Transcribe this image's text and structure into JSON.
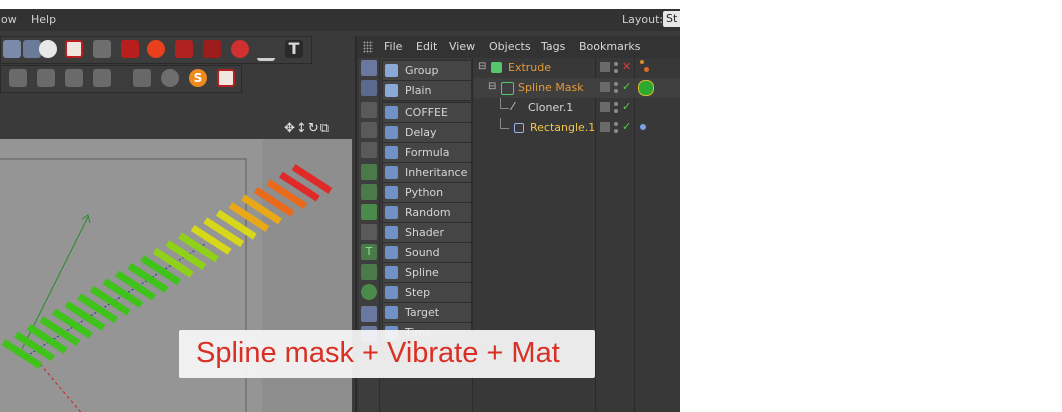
{
  "menubar": {
    "items": [
      "low",
      "Help"
    ],
    "layout_label": "Layout:",
    "layout_value": "St"
  },
  "viewport": {
    "nav_icons": [
      "move-view-icon",
      "pan-icon",
      "rotate-view-icon",
      "maximize-view-icon"
    ]
  },
  "object_manager": {
    "menu": [
      "File",
      "Edit",
      "View",
      "Objects",
      "Tags",
      "Bookmarks"
    ],
    "tag_items": [
      {
        "label": "Group",
        "icon": "group-icon",
        "color": "#8aa8d8"
      },
      {
        "label": "Plain",
        "icon": "plain-icon",
        "color": "#8aa8d8"
      },
      {
        "label": "COFFEE",
        "icon": "coffee-icon",
        "color": "#7090c8"
      },
      {
        "label": "Delay",
        "icon": "delay-icon",
        "color": "#7090c8"
      },
      {
        "label": "Formula",
        "icon": "formula-icon",
        "color": "#7090c8"
      },
      {
        "label": "Inheritance",
        "icon": "inheritance-icon",
        "color": "#7090c8"
      },
      {
        "label": "Python",
        "icon": "python-icon",
        "color": "#7090c8"
      },
      {
        "label": "Random",
        "icon": "random-icon",
        "color": "#7090c8"
      },
      {
        "label": "Shader",
        "icon": "shader-icon",
        "color": "#7090c8"
      },
      {
        "label": "Sound",
        "icon": "sound-icon",
        "color": "#7090c8"
      },
      {
        "label": "Spline",
        "icon": "spline-icon",
        "color": "#7090c8"
      },
      {
        "label": "Step",
        "icon": "step-icon",
        "color": "#7090c8"
      },
      {
        "label": "Target",
        "icon": "target-icon",
        "color": "#7090c8"
      },
      {
        "label": "Time",
        "icon": "time-icon",
        "color": "#7090c8"
      }
    ],
    "tree": [
      {
        "name": "Extrude",
        "color": "#e39a3a",
        "icon": "extrude-icon",
        "status": "off"
      },
      {
        "name": "Spline Mask",
        "color": "#e39a3a",
        "icon": "spline-mask-icon",
        "status": "on"
      },
      {
        "name": "Cloner.1",
        "color": "#d6d6d6",
        "icon": "cloner-icon",
        "status": "on"
      },
      {
        "name": "Rectangle.1",
        "color": "#f2c54a",
        "icon": "rectangle-icon",
        "status": "on"
      }
    ]
  },
  "caption": {
    "text": "Spline mask + Vibrate + Mat"
  },
  "colors": {
    "accent_check": "#55d04a",
    "accent_x": "#e03a3a",
    "caption_text": "#d93025"
  }
}
